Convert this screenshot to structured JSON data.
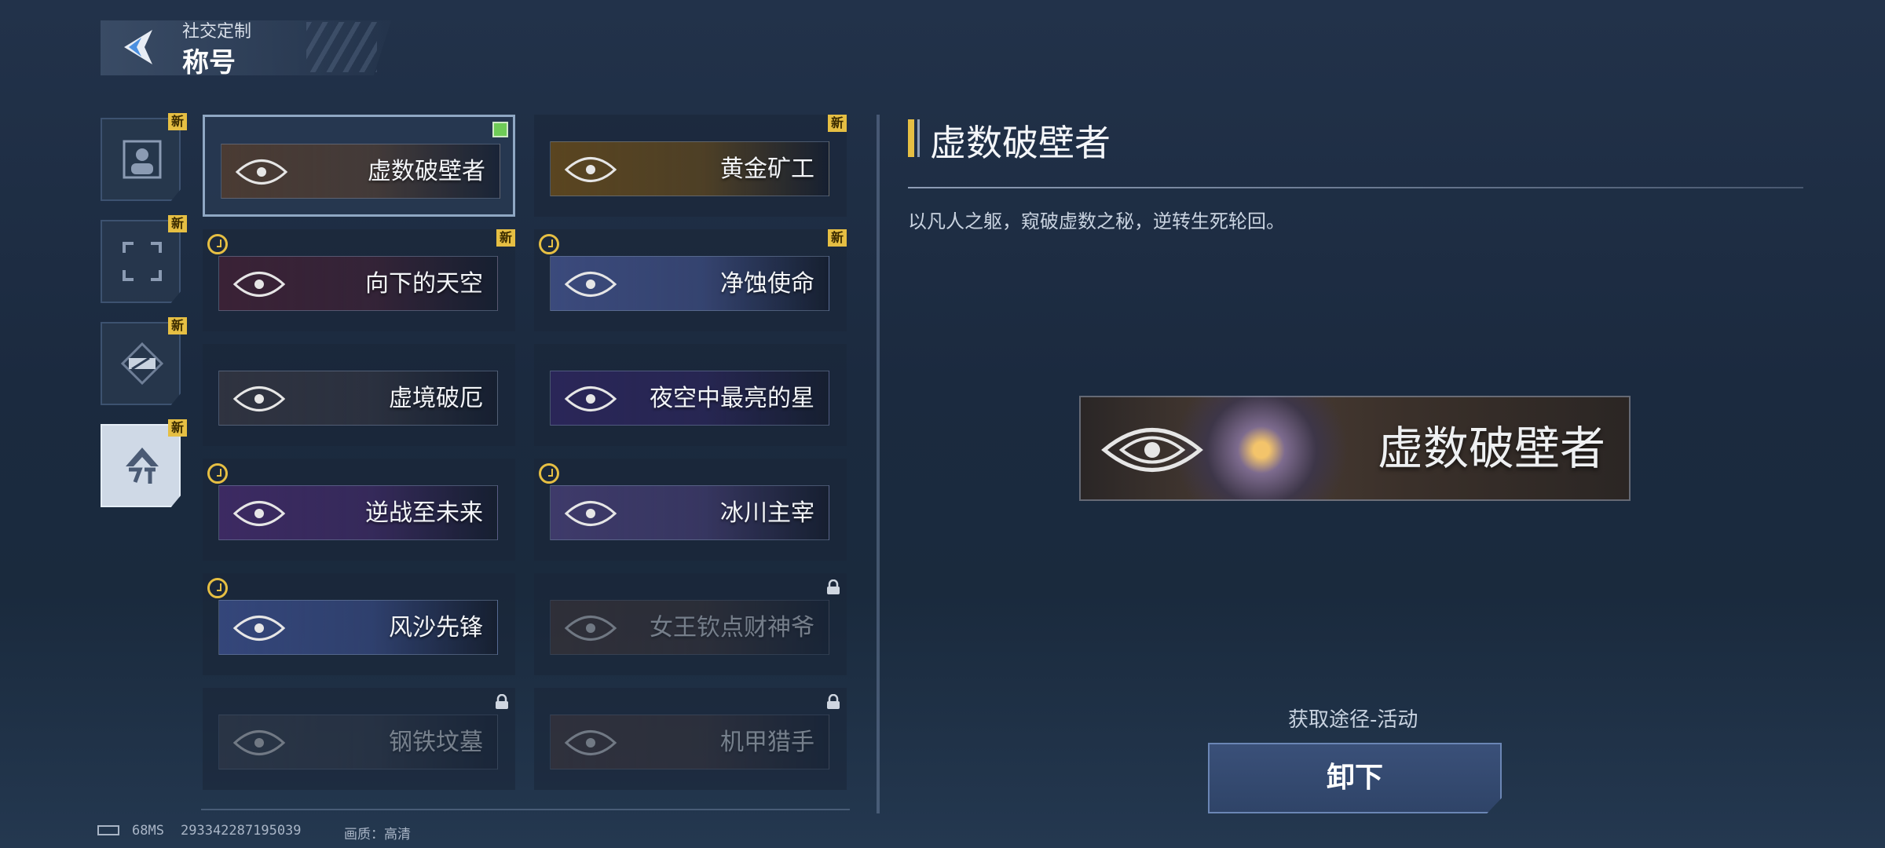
{
  "header": {
    "subtitle": "社交定制",
    "title": "称号"
  },
  "categories": [
    {
      "id": "avatar",
      "badge": "新",
      "active": false
    },
    {
      "id": "frame",
      "badge": "新",
      "active": false
    },
    {
      "id": "nameplate",
      "badge": "新",
      "active": false
    },
    {
      "id": "title",
      "badge": "新",
      "active": true
    }
  ],
  "titles": [
    {
      "label": "虚数破壁者",
      "badge": "",
      "timed": false,
      "locked": false,
      "selected": true,
      "equipped": true,
      "bg": "#4a3b33"
    },
    {
      "label": "黄金矿工",
      "badge": "新",
      "timed": false,
      "locked": false,
      "selected": false,
      "equipped": false,
      "bg": "#5a4520"
    },
    {
      "label": "向下的天空",
      "badge": "新",
      "timed": true,
      "locked": false,
      "selected": false,
      "equipped": false,
      "bg": "#3a2236"
    },
    {
      "label": "净蚀使命",
      "badge": "新",
      "timed": true,
      "locked": false,
      "selected": false,
      "equipped": false,
      "bg": "#3b4a7c"
    },
    {
      "label": "虚境破厄",
      "badge": "",
      "timed": false,
      "locked": false,
      "selected": false,
      "equipped": false,
      "bg": "#2f3340"
    },
    {
      "label": "夜空中最亮的星",
      "badge": "",
      "timed": false,
      "locked": false,
      "selected": false,
      "equipped": false,
      "bg": "#2a2658"
    },
    {
      "label": "逆战至未来",
      "badge": "",
      "timed": true,
      "locked": false,
      "selected": false,
      "equipped": false,
      "bg": "#3c2a62"
    },
    {
      "label": "冰川主宰",
      "badge": "",
      "timed": true,
      "locked": false,
      "selected": false,
      "equipped": false,
      "bg": "#3e3a6a"
    },
    {
      "label": "风沙先锋",
      "badge": "",
      "timed": true,
      "locked": false,
      "selected": false,
      "equipped": false,
      "bg": "#34467a"
    },
    {
      "label": "女王钦点财神爷",
      "badge": "",
      "timed": false,
      "locked": true,
      "selected": false,
      "equipped": false,
      "bg": "#4c3a36"
    },
    {
      "label": "钢铁坟墓",
      "badge": "",
      "timed": false,
      "locked": true,
      "selected": false,
      "equipped": false,
      "bg": "#3c4250"
    },
    {
      "label": "机甲猎手",
      "badge": "",
      "timed": false,
      "locked": true,
      "selected": false,
      "equipped": false,
      "bg": "#4a3a3a"
    }
  ],
  "detail": {
    "title": "虚数破壁者",
    "description": "以凡人之躯，窥破虚数之秘，逆转生死轮回。",
    "preview_label": "虚数破壁者",
    "source": "获取途径-活动",
    "unequip_label": "卸下"
  },
  "footer": {
    "ping": "68MS",
    "uid": "293342287195039",
    "quality": "画质：高清"
  },
  "colors": {
    "accent": "#e6bf43",
    "equipped": "#6ecb57",
    "button": "#3a5079"
  }
}
